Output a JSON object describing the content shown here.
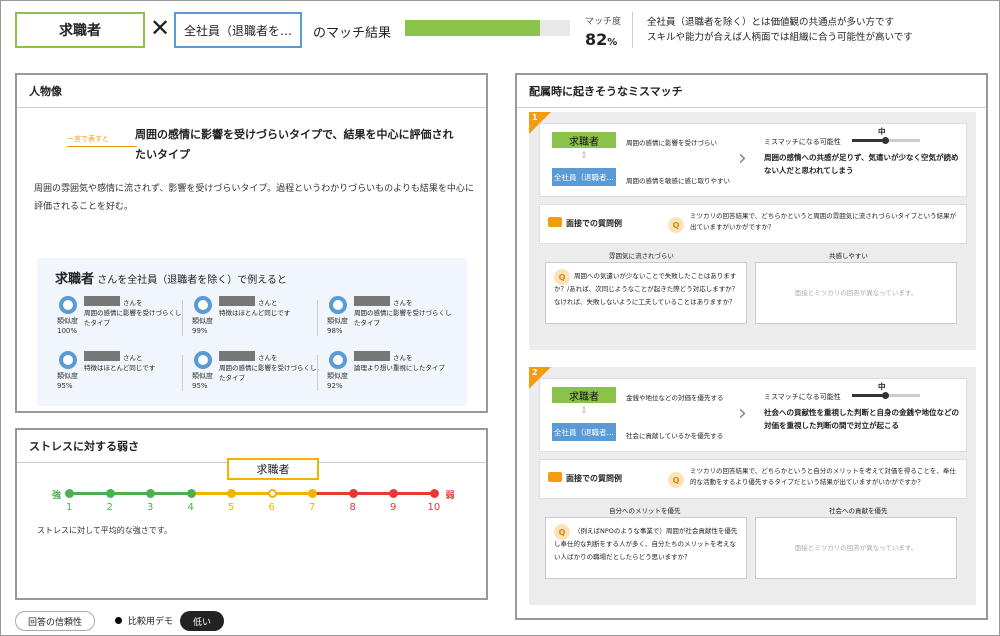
{
  "header": {
    "seeker": "求職者",
    "times": "✕",
    "employee": "全社員（退職者を…",
    "match_title": "のマッチ結果",
    "match_label": "マッチ度",
    "match_value": 82,
    "match_percent_sign": "%",
    "description_lines": [
      "全社員（退職者を除く）とは価値観の共通点が多い方です",
      "スキルや能力が合えば人柄面では組織に合う可能性が高いです"
    ]
  },
  "persona": {
    "title": "人物像",
    "oneword_tag": "一言で表すと",
    "headline": "周囲の感情に影響を受けづらいタイプで、結果を中心に評価されたいタイプ",
    "description": "周囲の雰囲気や感情に流されず、影響を受けづらいタイプ。過程というわかりづらいものよりも結果を中心に評価されることを好む。",
    "compare_title_bold": "求職者",
    "compare_title_rest": " さんを全社員（退職者を除く）で例えると",
    "items": [
      {
        "san": "さんを",
        "sim_label": "類似度",
        "sim": "100%",
        "text": "周囲の感情に影響を受けづらくしたタイプ"
      },
      {
        "san": "さんと",
        "sim_label": "類似度",
        "sim": "99%",
        "text": "特徴はほとんど同じです"
      },
      {
        "san": "さんを",
        "sim_label": "類似度",
        "sim": "98%",
        "text": "周囲の感情に影響を受けづらくしたタイプ"
      },
      {
        "san": "さんと",
        "sim_label": "類似度",
        "sim": "95%",
        "text": "特徴はほとんど同じです"
      },
      {
        "san": "さんを",
        "sim_label": "類似度",
        "sim": "95%",
        "text": "周囲の感情に影響を受けづらくしたタイプ"
      },
      {
        "san": "さんを",
        "sim_label": "類似度",
        "sim": "92%",
        "text": "論理より想い重視にしたタイプ"
      }
    ]
  },
  "stress": {
    "title": "ストレスに対する弱さ",
    "marker": "求職者",
    "strong": "強",
    "weak": "弱",
    "numbers": [
      "1",
      "2",
      "3",
      "4",
      "5",
      "6",
      "7",
      "8",
      "9",
      "10"
    ],
    "marker_value": 6,
    "segment_colors": [
      "#4caf50",
      "#f0b400",
      "#e53935"
    ],
    "description": "ストレスに対して平均的な強さです。"
  },
  "footer": {
    "reliability": "回答の信頼性",
    "demo": "比較用デモ",
    "badge": "低い"
  },
  "mismatch": {
    "title": "配属時に起きそうなミスマッチ",
    "cards": [
      {
        "num": "1",
        "seeker": "求職者",
        "employee": "全社員（退職者…",
        "trait_a": "周囲の感情に影響を受けづらい",
        "trait_b": "周囲の感情を敏感に感じ取りやすい",
        "poss_label": "ミスマッチになる可能性",
        "poss_level": "中",
        "poss_text": "周囲の感情への共感が足りず、気遣いが少なく空気が読めない人だと思われてしまう",
        "q_label": "面接での質問例",
        "q_text": "ミツカリの回答結果で、どちらかというと周囲の雰囲気に流されづらいタイプという結果が出ていますがいかがですか？",
        "col_a": "雰囲気に流されづらい",
        "col_b": "共感しやすい",
        "ans_a": "周囲への気遣いが少ないことで失敗したことはありますか？/あれば、次同じようなことが起きた際どう対応しますか？なければ、失敗しないように工夫していることはありますか？",
        "ans_b_lines": [
          "面接とミツカリの回答が",
          "異なっています。"
        ]
      },
      {
        "num": "2",
        "seeker": "求職者",
        "employee": "全社員（退職者…",
        "trait_a": "金銭や地位などの対価を優先する",
        "trait_b": "社会に貢献しているかを優先する",
        "poss_label": "ミスマッチになる可能性",
        "poss_level": "中",
        "poss_text": "社会への貢献性を重視した判断と自身の金銭や地位などの対価を重視した判断の間で対立が起こる",
        "q_label": "面接での質問例",
        "q_text": "ミツカリの回答結果で、どちらかというと自分のメリットを考えて対価を得ることを、奉仕的な活動をするより優先するタイプだという結果が出ていますがいかがですか？",
        "col_a": "自分へのメリットを優先",
        "col_b": "社会への貢献を優先",
        "ans_a": "（例えばNPOのような事業で）周囲が社会貢献性を優先し奉仕的な判断をする人が多く、自分たちのメリットを考えない人ばかりの職場だとしたらどう思いますか？",
        "ans_b_lines": [
          "面接とミツカリの回答が",
          "異なっています。"
        ]
      }
    ]
  }
}
